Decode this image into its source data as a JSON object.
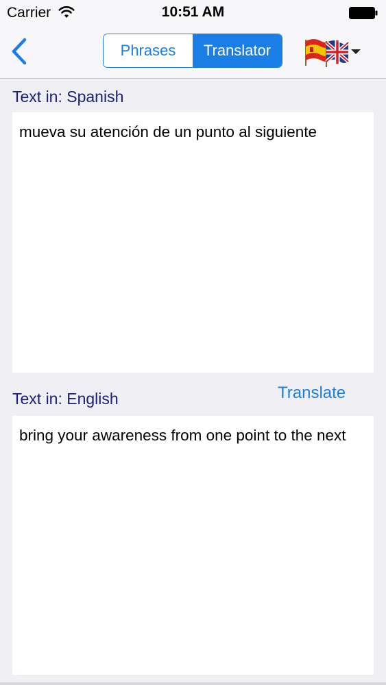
{
  "status_bar": {
    "carrier": "Carrier",
    "time": "10:51 AM",
    "wifi_icon": "wifi-icon",
    "battery_icon": "battery-icon"
  },
  "nav_bar": {
    "back_icon": "chevron-left-icon",
    "segments": [
      {
        "label": "Phrases",
        "selected": false
      },
      {
        "label": "Translator",
        "selected": true
      }
    ],
    "language_switch_icon": "spain-uk-flags-icon"
  },
  "source": {
    "label": "Text in: Spanish",
    "text": "mueva su atención de un punto al siguiente"
  },
  "target": {
    "label": "Text in: English",
    "text": "bring your awareness from one point to the next"
  },
  "actions": {
    "translate_label": "Translate"
  },
  "colors": {
    "accent": "#1a7ee6",
    "label_text": "#1c1c7a",
    "background": "#efeff4"
  }
}
